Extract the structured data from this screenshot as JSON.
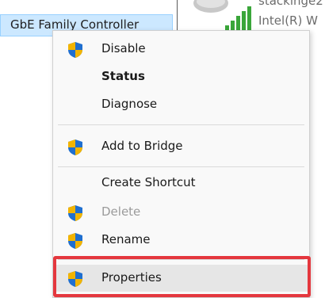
{
  "background": {
    "selected_adapter_label": "GbE Family Controller",
    "adapter2_name": "stackinge2",
    "adapter2_desc": "Intel(R) W"
  },
  "context_menu": {
    "items": [
      {
        "label": "Disable",
        "icon": "uac-shield-icon",
        "style": "normal"
      },
      {
        "label": "Status",
        "icon": "",
        "style": "bold"
      },
      {
        "label": "Diagnose",
        "icon": "",
        "style": "normal"
      },
      {
        "label": "Add to Bridge",
        "icon": "uac-shield-icon",
        "style": "normal"
      },
      {
        "label": "Create Shortcut",
        "icon": "",
        "style": "normal"
      },
      {
        "label": "Delete",
        "icon": "uac-shield-icon",
        "style": "disabled"
      },
      {
        "label": "Rename",
        "icon": "uac-shield-icon",
        "style": "normal"
      },
      {
        "label": "Properties",
        "icon": "uac-shield-icon",
        "style": "highlighted"
      }
    ]
  },
  "colors": {
    "highlight_border": "#e4373e",
    "selection_bg": "#cce8ff",
    "menu_bg": "#f9f9f9",
    "signal_bars": "#3aa63a"
  }
}
